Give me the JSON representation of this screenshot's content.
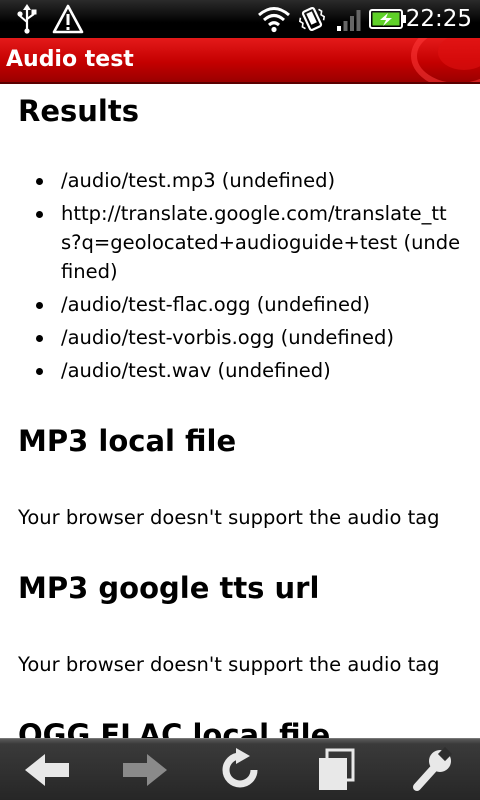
{
  "status_bar": {
    "time": "22:25",
    "icons": [
      "usb-icon",
      "warning-icon",
      "wifi-icon",
      "vibrate-icon",
      "signal-icon",
      "battery-charging-icon"
    ]
  },
  "title_bar": {
    "title": "Audio test"
  },
  "content": {
    "results_heading": "Results",
    "results": [
      "/audio/test.mp3 (undefined)",
      "http://translate.google.com/translate_tts?q=geolocated+audioguide+test (undefined)",
      "/audio/test-flac.ogg (undefined)",
      "/audio/test-vorbis.ogg (undefined)",
      "/audio/test.wav (undefined)"
    ],
    "sections": [
      {
        "heading": "MP3 local file",
        "text": "Your browser doesn't support the audio tag"
      },
      {
        "heading": "MP3 google tts url",
        "text": "Your browser doesn't support the audio tag"
      },
      {
        "heading": "OGG FLAC local file"
      }
    ]
  },
  "toolbar": {
    "buttons": [
      "back-arrow-icon",
      "forward-arrow-icon",
      "refresh-icon",
      "windows-icon",
      "settings-wrench-icon"
    ]
  },
  "colors": {
    "title_bar": "#c40000",
    "status_bar": "#000000",
    "toolbar": "#2e2e2e",
    "battery": "#5fd128"
  }
}
